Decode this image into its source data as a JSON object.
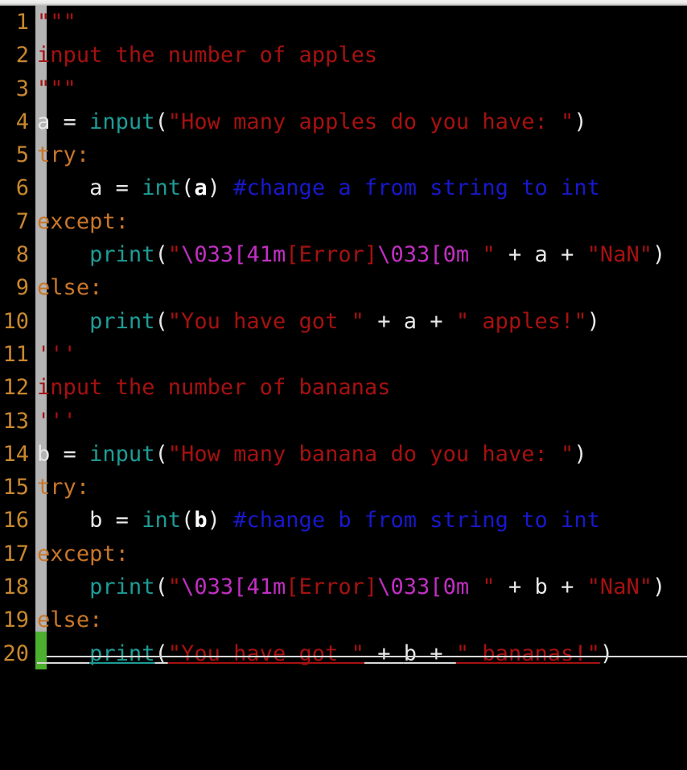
{
  "editor": {
    "language": "Python",
    "theme": "dark",
    "background_color": "#000000",
    "gutter_bar_color": "#b4b4b4",
    "modified_marker_color": "#4caf2f",
    "line_number_color": "#c8872e",
    "total_lines": 20,
    "first_visible_line": 1,
    "last_visible_line": 20
  },
  "syntax_colors": {
    "string": "#a51111",
    "keyword": "#c8762a",
    "function": "#1e9c96",
    "plain": "#e8e8e8",
    "comment": "#1818cc",
    "escape": "#c22fc2"
  },
  "line_numbers": [
    "1",
    "2",
    "3",
    "4",
    "5",
    "6",
    "7",
    "8",
    "9",
    "10",
    "11",
    "12",
    "13",
    "14",
    "15",
    "16",
    "17",
    "18",
    "19",
    "20"
  ],
  "code": {
    "lines": [
      {
        "n": "1",
        "text": "\"\"\""
      },
      {
        "n": "2",
        "text": "input the number of apples"
      },
      {
        "n": "3",
        "text": "\"\"\""
      },
      {
        "n": "4",
        "text": "a = input(\"How many apples do you have: \")"
      },
      {
        "n": "5",
        "text": "try:"
      },
      {
        "n": "6",
        "text": "    a = int(a) #change a from string to int"
      },
      {
        "n": "7",
        "text": "except:"
      },
      {
        "n": "8",
        "text": "    print(\"\\033[41m[Error]\\033[0m \" + a + \"NaN\")"
      },
      {
        "n": "9",
        "text": "else:"
      },
      {
        "n": "10",
        "text": "    print(\"You have got \" + a + \" apples!\")"
      },
      {
        "n": "11",
        "text": "'''"
      },
      {
        "n": "12",
        "text": "input the number of bananas"
      },
      {
        "n": "13",
        "text": "'''"
      },
      {
        "n": "14",
        "text": "b = input(\"How many banana do you have: \")"
      },
      {
        "n": "15",
        "text": "try:"
      },
      {
        "n": "16",
        "text": "    b = int(b) #change b from string to int"
      },
      {
        "n": "17",
        "text": "except:"
      },
      {
        "n": "18",
        "text": "    print(\"\\033[41m[Error]\\033[0m \" + b + \"NaN\")"
      },
      {
        "n": "19",
        "text": "else:"
      },
      {
        "n": "20",
        "text": "    print(\"You have got \" + b + \" bananas!\")"
      }
    ]
  },
  "tokens": {
    "l1_docstring_open": "\"\"\"",
    "l2_docstring_body": "input the number of apples",
    "l3_docstring_close": "\"\"\"",
    "l4_var": "a",
    "l4_eq": " = ",
    "l4_fn": "input",
    "l4_paren_open": "(",
    "l4_str": "\"How many apples do you have: \"",
    "l4_paren_close": ")",
    "l5_kw": "try:",
    "l6_indent": "    ",
    "l6_var": "a",
    "l6_eq": " = ",
    "l6_fn": "int",
    "l6_paren_open": "(",
    "l6_arg": "a",
    "l6_paren_close": ")",
    "l6_space": " ",
    "l6_comment": "#change a from string to int",
    "l7_kw": "except:",
    "l8_indent": "    ",
    "l8_fn": "print",
    "l8_paren_open": "(",
    "l8_quote_open": "\"",
    "l8_esc1": "\\033[41m",
    "l8_err": "[Error]",
    "l8_esc2": "\\033[0m",
    "l8_str_tail": " \"",
    "l8_plus1": " + ",
    "l8_var": "a",
    "l8_plus2": " + ",
    "l8_nan": "\"NaN\"",
    "l8_paren_close": ")",
    "l9_kw": "else:",
    "l10_indent": "    ",
    "l10_fn": "print",
    "l10_paren_open": "(",
    "l10_str1": "\"You have got \"",
    "l10_plus1": " + ",
    "l10_var": "a",
    "l10_plus2": " + ",
    "l10_str2": "\" apples!\"",
    "l10_paren_close": ")",
    "l11_docstring_open": "'''",
    "l12_docstring_body": "input the number of bananas",
    "l13_docstring_close": "'''",
    "l14_var": "b",
    "l14_eq": " = ",
    "l14_fn": "input",
    "l14_paren_open": "(",
    "l14_str": "\"How many banana do you have: \"",
    "l14_paren_close": ")",
    "l15_kw": "try:",
    "l16_indent": "    ",
    "l16_var": "b",
    "l16_eq": " = ",
    "l16_fn": "int",
    "l16_paren_open": "(",
    "l16_arg": "b",
    "l16_paren_close": ")",
    "l16_space": " ",
    "l16_comment": "#change b from string to int",
    "l17_kw": "except:",
    "l18_indent": "    ",
    "l18_fn": "print",
    "l18_paren_open": "(",
    "l18_quote_open": "\"",
    "l18_esc1": "\\033[41m",
    "l18_err": "[Error]",
    "l18_esc2": "\\033[0m",
    "l18_str_tail": " \"",
    "l18_plus1": " + ",
    "l18_var": "b",
    "l18_plus2": " + ",
    "l18_nan": "\"NaN\"",
    "l18_paren_close": ")",
    "l19_kw": "else:",
    "l20_indent": "    ",
    "l20_fn": "print",
    "l20_paren_open": "(",
    "l20_str1": "\"You have got \"",
    "l20_plus1": " + ",
    "l20_var": "b",
    "l20_plus2": " + ",
    "l20_str2": "\" bananas!\"",
    "l20_paren_close": ")"
  }
}
